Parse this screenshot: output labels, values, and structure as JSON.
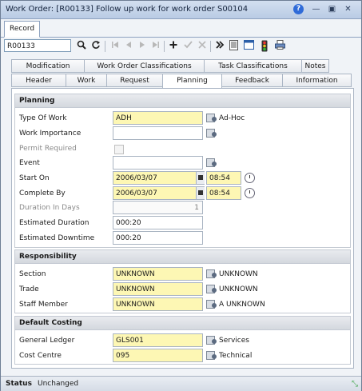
{
  "window": {
    "title": "Work Order: [R00133] Follow up work for work order S00104",
    "help_icon": "?",
    "minimize_icon": "—",
    "restore_icon": "▣",
    "close_icon": "✕"
  },
  "record_tab": "Record",
  "toolbar": {
    "record_value": "R00133",
    "icons": [
      "search-icon",
      "refresh-icon",
      "first-icon",
      "previous-icon",
      "next-icon",
      "last-icon",
      "add-icon",
      "accept-icon",
      "cancel-icon",
      "more-icon",
      "report-icon",
      "window-icon",
      "traffic-light-icon",
      "print-icon"
    ]
  },
  "tabs_row1": [
    "Modification",
    "Work Order Classifications",
    "Task Classifications",
    "Notes"
  ],
  "tabs_row2": [
    "Header",
    "Work",
    "Request",
    "Planning",
    "Feedback",
    "Information"
  ],
  "active_tab": "Planning",
  "planning": {
    "heading": "Planning",
    "type_of_work_label": "Type Of Work",
    "type_of_work_value": "ADH",
    "type_of_work_desc": "Ad-Hoc",
    "work_importance_label": "Work Importance",
    "work_importance_value": "",
    "permit_required_label": "Permit Required",
    "event_label": "Event",
    "event_value": "",
    "start_on_label": "Start On",
    "start_on_date": "2006/03/07",
    "start_on_time": "08:54",
    "complete_by_label": "Complete By",
    "complete_by_date": "2006/03/07",
    "complete_by_time": "08:54",
    "duration_label": "Duration In Days",
    "duration_value": "1",
    "est_duration_label": "Estimated Duration",
    "est_duration_value": "000:20",
    "est_downtime_label": "Estimated Downtime",
    "est_downtime_value": "000:20"
  },
  "responsibility": {
    "heading": "Responsibility",
    "section_label": "Section",
    "section_value": "UNKNOWN",
    "section_desc": "UNKNOWN",
    "trade_label": "Trade",
    "trade_value": "UNKNOWN",
    "trade_desc": "UNKNOWN",
    "staff_label": "Staff Member",
    "staff_value": "UNKNOWN",
    "staff_desc": "A UNKNOWN"
  },
  "costing": {
    "heading": "Default Costing",
    "gl_label": "General Ledger",
    "gl_value": "GLS001",
    "gl_desc": "Services",
    "cc_label": "Cost Centre",
    "cc_value": "095",
    "cc_desc": "Technical"
  },
  "status": {
    "label": "Status",
    "value": "Unchanged"
  },
  "colors": {
    "required_field": "#fdf7b4",
    "title_bar": "#c7d6ec"
  }
}
